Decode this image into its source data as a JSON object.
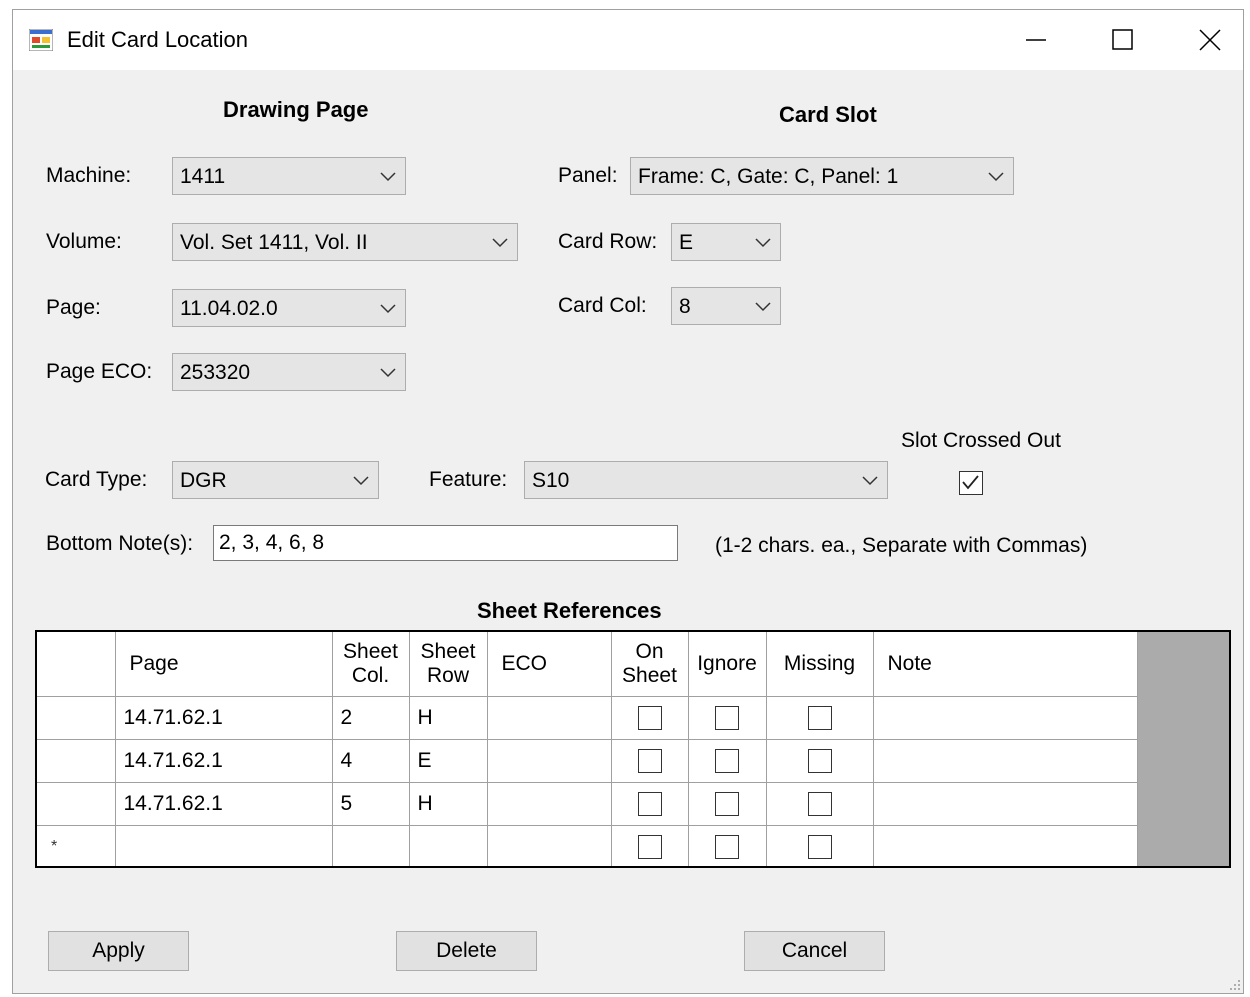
{
  "window": {
    "title": "Edit Card Location"
  },
  "drawing_page": {
    "title": "Drawing Page",
    "machine_label": "Machine:",
    "machine_value": "1411",
    "volume_label": "Volume:",
    "volume_value": "Vol. Set 1411, Vol. II",
    "page_label": "Page:",
    "page_value": "11.04.02.0",
    "page_eco_label": "Page ECO:",
    "page_eco_value": "253320"
  },
  "card_slot": {
    "title": "Card Slot",
    "panel_label": "Panel:",
    "panel_value": "Frame: C, Gate: C, Panel: 1",
    "card_row_label": "Card Row:",
    "card_row_value": "E",
    "card_col_label": "Card Col:",
    "card_col_value": "8"
  },
  "card": {
    "type_label": "Card Type:",
    "type_value": "DGR",
    "feature_label": "Feature:",
    "feature_value": "S10",
    "slot_crossed_out_label": "Slot Crossed Out",
    "slot_crossed_out": true,
    "bottom_notes_label": "Bottom Note(s):",
    "bottom_notes_value": "2, 3, 4, 6, 8",
    "bottom_notes_hint": "(1-2 chars. ea., Separate with Commas)"
  },
  "sheet_refs": {
    "title": "Sheet References",
    "columns": {
      "page": "Page",
      "sheet_col_1": "Sheet",
      "sheet_col_2": "Col.",
      "sheet_row_1": "Sheet",
      "sheet_row_2": "Row",
      "eco": "ECO",
      "on_sheet_1": "On",
      "on_sheet_2": "Sheet",
      "ignore": "Ignore",
      "missing": "Missing",
      "note": "Note"
    },
    "rows": [
      {
        "page": "14.71.62.1",
        "col": "2",
        "row": "H",
        "eco": "",
        "note": ""
      },
      {
        "page": "14.71.62.1",
        "col": "4",
        "row": "E",
        "eco": "",
        "note": ""
      },
      {
        "page": "14.71.62.1",
        "col": "5",
        "row": "H",
        "eco": "",
        "note": ""
      }
    ],
    "new_row_marker": "*"
  },
  "buttons": {
    "apply": "Apply",
    "delete": "Delete",
    "cancel": "Cancel"
  },
  "icons": {
    "app": "app-form-icon",
    "minimize": "minimize-icon",
    "maximize": "maximize-icon",
    "close": "close-icon",
    "dropdown": "chevron-down-icon",
    "check": "checkmark-icon",
    "grip": "resize-grip-icon"
  }
}
